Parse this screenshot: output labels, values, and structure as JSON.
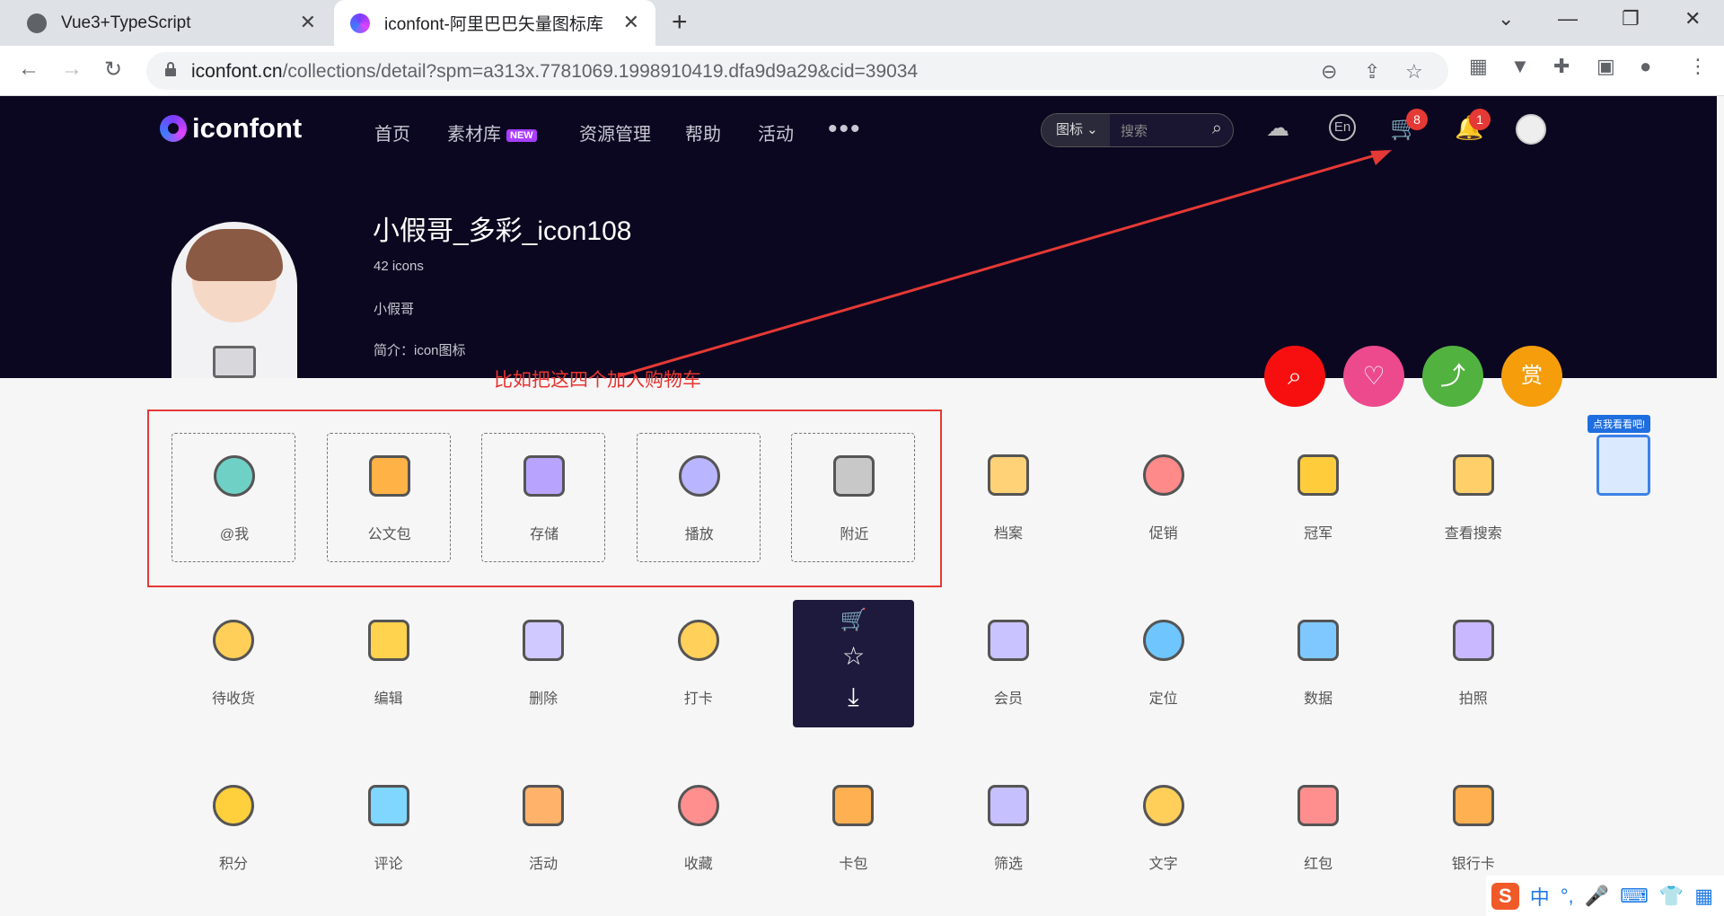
{
  "browser": {
    "tabs": [
      {
        "title": "Vue3+TypeScript"
      },
      {
        "title": "iconfont-阿里巴巴矢量图标库"
      }
    ],
    "url_domain": "iconfont.cn",
    "url_path": "/collections/detail?spm=a313x.7781069.1998910419.dfa9d9a29&cid=39034"
  },
  "site": {
    "logo": "iconfont",
    "menu": [
      "首页",
      "素材库",
      "资源管理",
      "帮助",
      "活动"
    ],
    "new_badge": "NEW",
    "search_type": "图标",
    "search_placeholder": "搜索",
    "lang": "En",
    "cart_count": "8",
    "notify_count": "1"
  },
  "collection": {
    "title": "小假哥_多彩_icon108",
    "count": "42 icons",
    "author": "小假哥",
    "intro": "简介：icon图标"
  },
  "annotation": "比如把这四个加入购物车",
  "actions": {
    "reward": "赏"
  },
  "clipboard_tip": "点我看看吧!",
  "icons": [
    {
      "label": "@我",
      "icon": "at-icon",
      "selected": true
    },
    {
      "label": "公文包",
      "icon": "briefcase-icon",
      "selected": true
    },
    {
      "label": "存储",
      "icon": "storage-icon",
      "selected": true
    },
    {
      "label": "播放",
      "icon": "play-icon",
      "selected": true
    },
    {
      "label": "附近",
      "icon": "pie-icon",
      "selected": true
    },
    {
      "label": "档案",
      "icon": "archive-icon"
    },
    {
      "label": "促销",
      "icon": "promo-icon"
    },
    {
      "label": "冠军",
      "icon": "trophy-icon"
    },
    {
      "label": "查看搜索",
      "icon": "doc-search-icon"
    },
    {
      "label": "待收货",
      "icon": "pending-icon"
    },
    {
      "label": "编辑",
      "icon": "edit-icon"
    },
    {
      "label": "删除",
      "icon": "trash-icon"
    },
    {
      "label": "打卡",
      "icon": "checkin-icon"
    },
    {
      "label": "",
      "icon": "hover-icon"
    },
    {
      "label": "会员",
      "icon": "member-icon"
    },
    {
      "label": "定位",
      "icon": "location-icon"
    },
    {
      "label": "数据",
      "icon": "data-icon"
    },
    {
      "label": "拍照",
      "icon": "camera-icon"
    },
    {
      "label": "积分",
      "icon": "points-icon"
    },
    {
      "label": "评论",
      "icon": "comment-icon"
    },
    {
      "label": "活动",
      "icon": "activity-icon"
    },
    {
      "label": "收藏",
      "icon": "favorite-icon"
    },
    {
      "label": "卡包",
      "icon": "wallet-icon"
    },
    {
      "label": "筛选",
      "icon": "filter-icon"
    },
    {
      "label": "文字",
      "icon": "text-icon"
    },
    {
      "label": "红包",
      "icon": "redpacket-icon"
    },
    {
      "label": "银行卡",
      "icon": "bankcard-icon"
    }
  ],
  "ime": {
    "label": "中"
  }
}
